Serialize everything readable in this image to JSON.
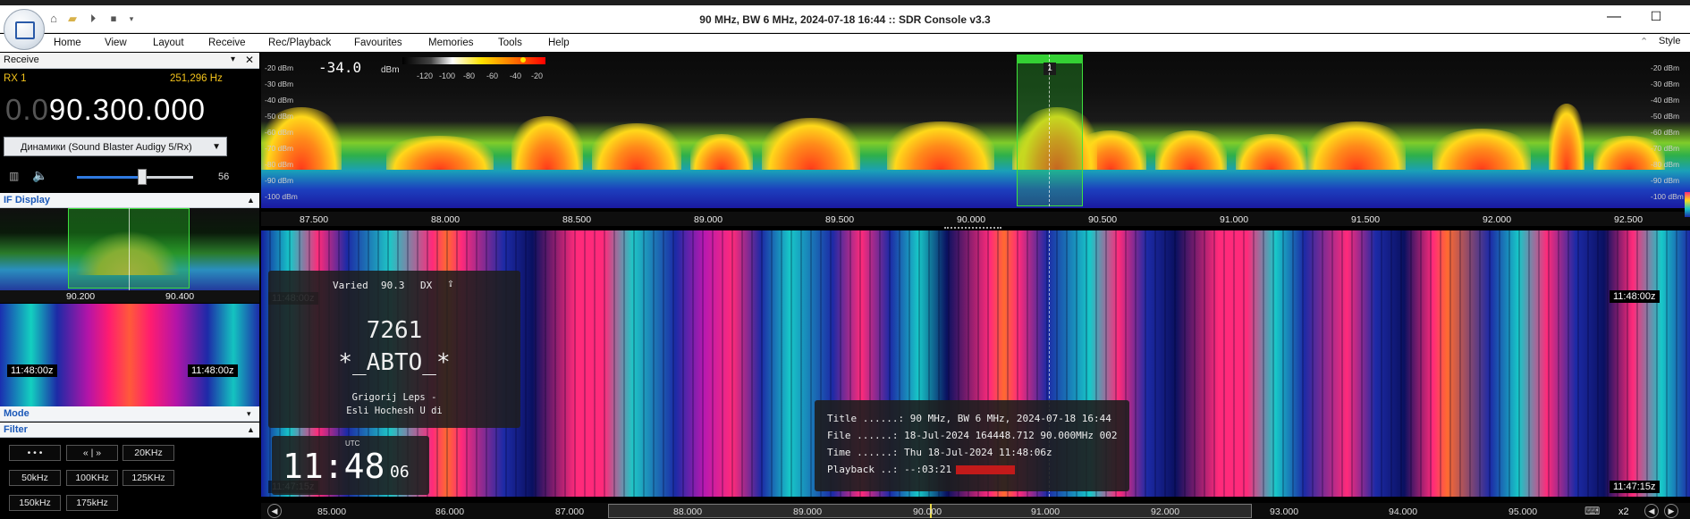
{
  "window": {
    "title": "90 MHz, BW 6 MHz, 2024-07-18 16:44 :: SDR Console v3.3"
  },
  "menu": [
    "Home",
    "View",
    "Layout",
    "Receive",
    "Rec/Playback",
    "Favourites",
    "Memories",
    "Tools",
    "Help"
  ],
  "style_label": "Style",
  "receive_panel": {
    "header": "Receive",
    "rx_label": "RX 1",
    "offset_hz": "251,296 Hz",
    "freq_dim": "0.0",
    "freq_main": "90.300.000",
    "audio_device": "Динамики (Sound Blaster Audigy 5/Rx)",
    "volume": "56",
    "volume_fraction": 0.56
  },
  "if_display": {
    "header": "IF Display",
    "ticks": [
      "90.200",
      "90.400"
    ],
    "stamp": "11:48:00z"
  },
  "mode_header": "Mode",
  "filter": {
    "header": "Filter",
    "buttons": [
      "• • •",
      "« | »",
      "20KHz",
      "50kHz",
      "100KHz",
      "125KHz",
      "150kHz",
      "175kHz"
    ]
  },
  "spectrum": {
    "signal_level": "-34.0",
    "signal_unit": "dBm",
    "colorbar_labels": [
      "-120",
      "-100",
      "-80",
      "-60",
      "-40",
      "-20"
    ],
    "dbm_scale": [
      "-20 dBm",
      "-30 dBm",
      "-40 dBm",
      "-50 dBm",
      "-60 dBm",
      "-70 dBm",
      "-80 dBm",
      "-90 dBm",
      "-100 dBm"
    ],
    "marker_number": "1",
    "axis_ticks": [
      "87.500",
      "88.000",
      "88.500",
      "89.000",
      "89.500",
      "90.000",
      "90.500",
      "91.000",
      "91.500",
      "92.000",
      "92.500"
    ]
  },
  "waterfall": {
    "stamp_top": "11:48:00z",
    "stamp_bottom": "11:47:15z",
    "bottom_ticks": [
      "85.000",
      "86.000",
      "87.000",
      "88.000",
      "89.000",
      "90.000",
      "91.000",
      "92.000",
      "93.000",
      "94.000",
      "95.000"
    ],
    "zoom": "x2"
  },
  "rds": {
    "pty": "Varied",
    "freq": "90.3",
    "dx": "DX",
    "pi": "7261",
    "ps": "*_ABTO_*",
    "rt_line1": "Grigorij Leps -",
    "rt_line2": "Esli Hochesh U  di"
  },
  "clock": {
    "utc_label": "UTC",
    "time": "11:48",
    "seconds": "06"
  },
  "info": {
    "title_line": "Title ......: 90 MHz, BW 6 MHz, 2024-07-18 16:44",
    "file_line": "File ......: 18-Jul-2024 164448.712 90.000MHz 002",
    "time_line": "Time ......: Thu 18-Jul-2024 11:48:06z",
    "playback_line": "Playback ..: --:03:21"
  }
}
